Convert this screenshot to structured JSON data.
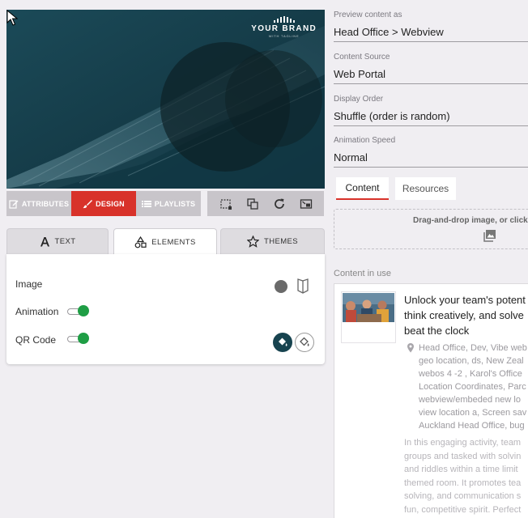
{
  "preview": {
    "brand_name": "YOUR BRAND",
    "brand_tagline": "WITH TAGLINE"
  },
  "mode_bar": {
    "attributes_label": "ATTRIBUTES",
    "design_label": "DESIGN",
    "playlists_label": "PLAYLISTS",
    "active": "DESIGN",
    "accent_color": "#d8322a"
  },
  "tools": [
    "crop-icon",
    "copy-icon",
    "refresh-icon",
    "picture-in-picture-icon"
  ],
  "tabs": {
    "text_label": "TEXT",
    "elements_label": "ELEMENTS",
    "themes_label": "THEMES",
    "active": "ELEMENTS"
  },
  "elements": {
    "image_label": "Image",
    "animation_label": "Animation",
    "animation_on": true,
    "qr_label": "QR Code",
    "qr_on": true,
    "toggle_color": "#1f9e45"
  },
  "settings": {
    "preview_as_label": "Preview content as",
    "preview_as_value": "Head Office > Webview",
    "source_label": "Content Source",
    "source_value": "Web Portal",
    "order_label": "Display Order",
    "order_value": "Shuffle (order is random)",
    "speed_label": "Animation Speed",
    "speed_value": "Normal"
  },
  "right_tabs": {
    "content_label": "Content",
    "resources_label": "Resources",
    "active": "Content"
  },
  "dropzone": {
    "text": "Drag-and-drop image, or click"
  },
  "content_in_use": {
    "label": "Content in use",
    "title_lines": [
      "Unlock your team's potent",
      "think creatively, and solve",
      "beat the clock"
    ],
    "location_lines": [
      "Head Office, Dev, Vibe web",
      "geo location, ds, New Zeal",
      "webos 4 -2 , Karol's Office",
      "Location Coordinates, Parc",
      "webview/embeded new lo",
      "view location a, Screen sav",
      "Auckland Head Office, bug"
    ],
    "description_lines": [
      "In this engaging activity, team",
      "groups and tasked with solvin",
      "and riddles within a time limit",
      "themed room. It promotes tea",
      "solving, and communication s",
      "fun, competitive spirit. Perfect"
    ]
  }
}
